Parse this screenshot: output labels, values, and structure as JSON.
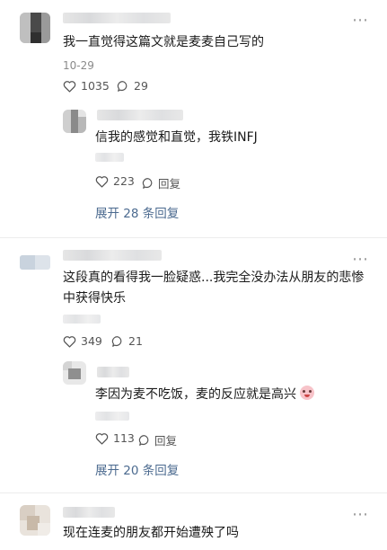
{
  "comments": [
    {
      "text": "我一直觉得这篇文就是麦麦自己写的",
      "date": "10-29",
      "likes": "1035",
      "replies_count": "29",
      "reply": {
        "text": "信我的感觉和直觉，我铁INFJ",
        "likes": "223",
        "reply_label": "回复"
      },
      "expand_label": "展开 28 条回复"
    },
    {
      "text_line1": "这段真的看得我一脸疑惑...我完全没办法从朋友的悲惨",
      "text_line2": "中获得快乐",
      "likes": "349",
      "replies_count": "21",
      "reply": {
        "text": "李因为麦不吃饭，麦的反应就是高兴",
        "likes": "113",
        "reply_label": "回复"
      },
      "expand_label": "展开 20 条回复"
    },
    {
      "text": "现在连麦的朋友都开始遭殃了吗"
    }
  ],
  "more_icon": "more-dots-icon",
  "colors": {
    "link": "#4b6a8f",
    "meta": "#8a8a8a"
  }
}
